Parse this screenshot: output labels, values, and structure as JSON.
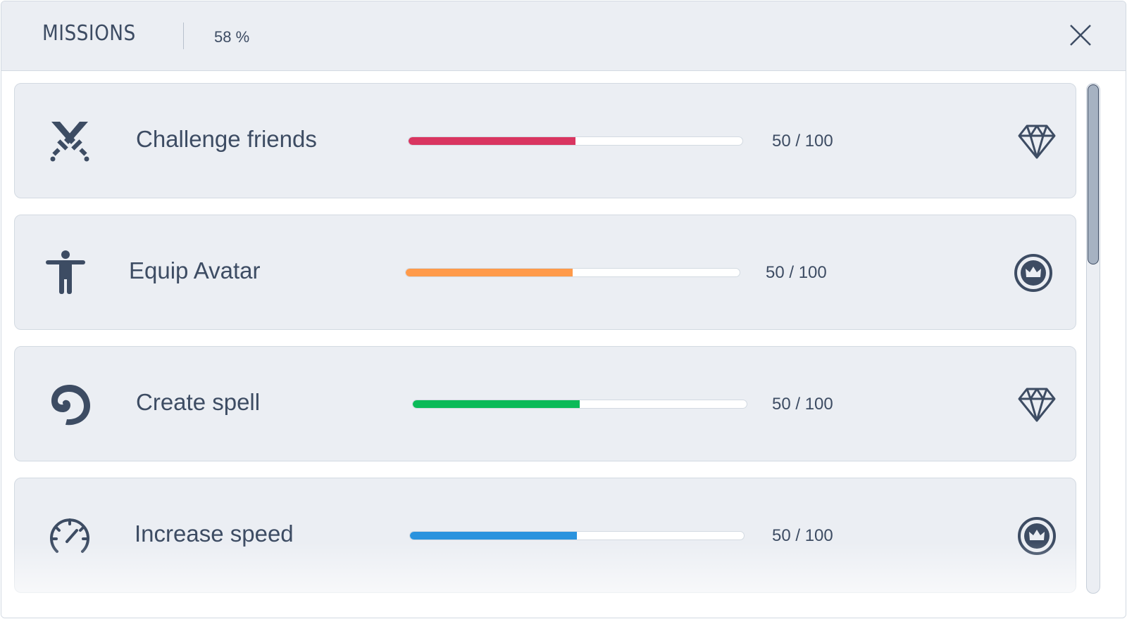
{
  "header": {
    "title": "MISSIONS",
    "progress": "58 %",
    "close_icon": "close-icon"
  },
  "missions": [
    {
      "title": "Challenge friends",
      "icon": "crossed-swords-icon",
      "progress": 50,
      "max": 100,
      "count": "50 / 100",
      "color": "#d93560",
      "reward_icon": "diamond-icon"
    },
    {
      "title": "Equip Avatar",
      "icon": "avatar-icon",
      "progress": 50,
      "max": 100,
      "count": "50 / 100",
      "color": "#ff9a4a",
      "reward_icon": "crown-coin-icon"
    },
    {
      "title": "Create spell",
      "icon": "spiral-spell-icon",
      "progress": 50,
      "max": 100,
      "count": "50 / 100",
      "color": "#0bba58",
      "reward_icon": "diamond-icon"
    },
    {
      "title": "Increase speed",
      "icon": "speedometer-icon",
      "progress": 50,
      "max": 100,
      "count": "50 / 100",
      "color": "#2a93de",
      "reward_icon": "crown-coin-icon"
    }
  ],
  "colors": {
    "text": "#3d4c63",
    "card_bg": "#ebeef3",
    "border": "#d3dae2"
  },
  "scroll_position": 0
}
